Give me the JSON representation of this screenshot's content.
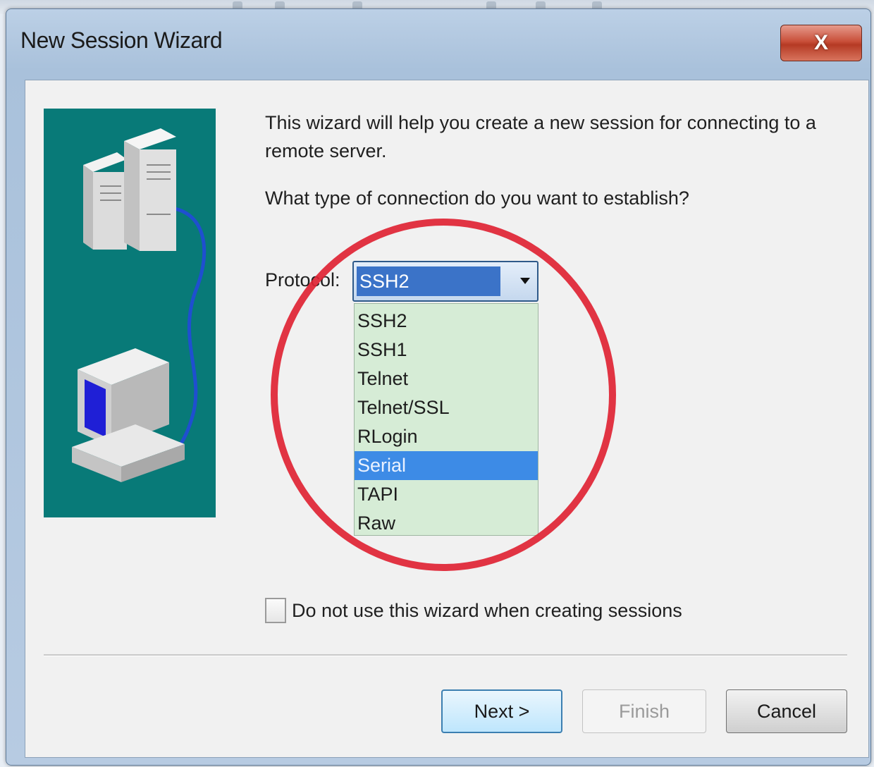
{
  "window": {
    "title": "New Session Wizard",
    "close_label": "X"
  },
  "wizard": {
    "intro": "This wizard will help you create a new session for connecting to a remote server.",
    "question": "What type of connection do you want to establish?",
    "protocol_label": "Protocol:",
    "protocol_selected": "SSH2",
    "protocol_options": [
      "SSH2",
      "SSH1",
      "Telnet",
      "Telnet/SSL",
      "RLogin",
      "Serial",
      "TAPI",
      "Raw"
    ],
    "highlighted_option": "Serial",
    "dont_use_checkbox_label": "Do not use this wizard when creating sessions",
    "dont_use_checked": false
  },
  "buttons": {
    "next": "Next >",
    "finish": "Finish",
    "cancel": "Cancel"
  },
  "colors": {
    "illustration_bg": "#087a78",
    "annotation_circle": "#e02434",
    "highlight": "#3d8be6"
  },
  "icons": [
    "server-tower-icon",
    "computer-workstation-icon",
    "dropdown-arrow-icon"
  ]
}
